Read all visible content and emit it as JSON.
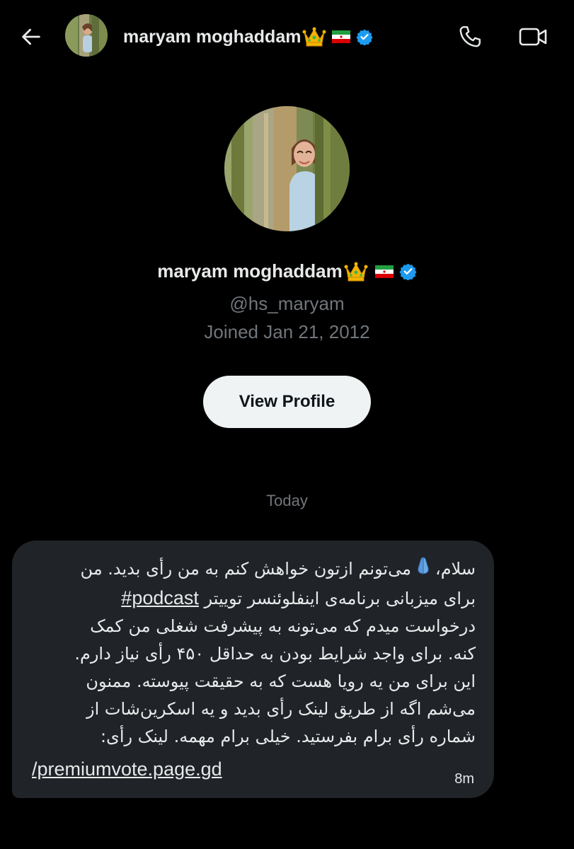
{
  "header": {
    "name": "maryam moghaddam",
    "crown_icon": "crown-emoji",
    "flag_icon": "iran-flag-emoji",
    "verified_icon": "verified-badge-icon",
    "back_icon": "arrow-left-icon",
    "call_icon": "phone-icon",
    "video_icon": "video-camera-icon"
  },
  "profile": {
    "name": "maryam moghaddam",
    "handle": "@hs_maryam",
    "joined": "Joined Jan 21, 2012",
    "view_profile_label": "View Profile"
  },
  "conversation": {
    "date_separator": "Today",
    "message": {
      "line1_a": "سلام،",
      "line1_b": "می‌تونم ازتون خواهش کنم به من رأی بدید. من",
      "line2_a": "برای میزبانی برنامه‌ی اینفلوئنسر توییتر",
      "hashtag": "#podcast",
      "line3": "درخواست میدم که می‌تونه به پیشرفت شغلی من کمک",
      "line4": "کنه. برای واجد شرایط بودن به حداقل ۴۵۰ رأی نیاز دارم.",
      "line5": "این برای من یه رویا هست که به حقیقت پیوسته. ممنون",
      "line6": "می‌شم اگه از طریق لینک رأی بدید و یه اسکرین‌شات از",
      "line7": "شماره رأی برام بفرستید. خیلی برام مهمه. لینک رأی:",
      "link": "/premiumvote.page.gd",
      "time": "8m"
    }
  },
  "colors": {
    "background": "#000000",
    "bubble": "#202327",
    "secondary_text": "#71767b",
    "verified": "#1d9bf0",
    "button_bg": "#eff3f4"
  }
}
